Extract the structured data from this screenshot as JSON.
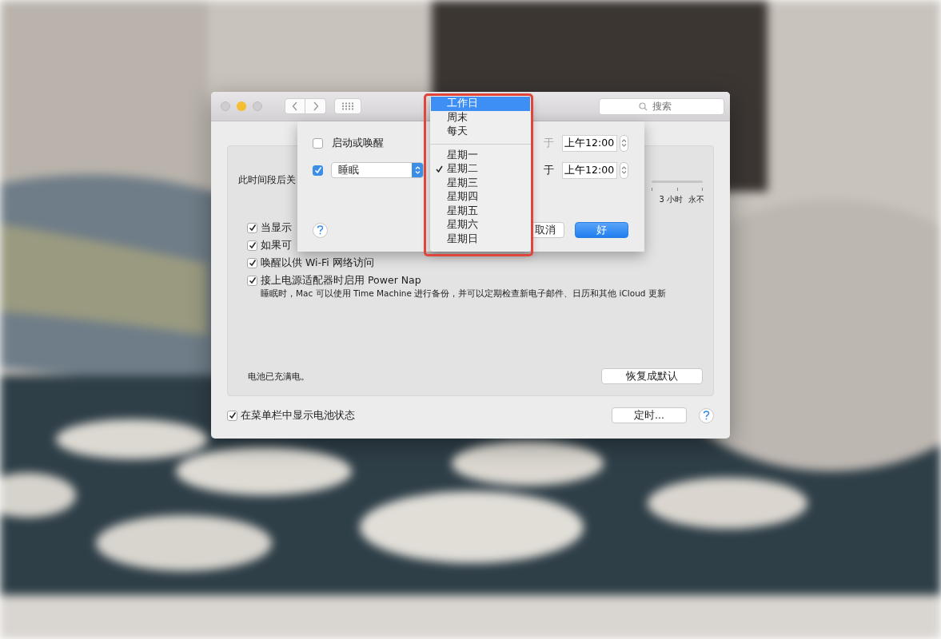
{
  "toolbar": {
    "search": {
      "placeholder": "搜索"
    }
  },
  "panel": {
    "slider_label": "此时间段后关",
    "slider_labels": [
      "3 小时",
      "永不"
    ],
    "options": [
      {
        "label": "当显示",
        "checked": true
      },
      {
        "label": "如果可",
        "checked": true
      },
      {
        "label": "唤醒以供 Wi-Fi 网络访问",
        "checked": true
      },
      {
        "label": "接上电源适配器时启用 Power Nap",
        "checked": true
      }
    ],
    "note": "睡眠时，Mac 可以使用 Time Machine 进行备份，并可以定期检查新电子邮件、日历和其他 iCloud 更新",
    "battery_status": "电池已充满电。",
    "restore_button": "恢复成默认"
  },
  "footer": {
    "show_battery": {
      "label": "在菜单栏中显示电池状态",
      "checked": true
    },
    "schedule_button": "定时..."
  },
  "schedule_sheet": {
    "rows": [
      {
        "kind": "label",
        "checked": false,
        "event": "启动或唤醒",
        "at": "于",
        "time": "上午12:00"
      },
      {
        "kind": "popup",
        "checked": true,
        "event": "睡眠",
        "at": "于",
        "time": "上午12:00"
      }
    ],
    "cancel_button": "取消",
    "ok_button": "好"
  },
  "day_menu": {
    "groups": [
      [
        {
          "label": "工作日",
          "selected": true,
          "checked": false
        },
        {
          "label": "周末",
          "selected": false,
          "checked": false
        },
        {
          "label": "每天",
          "selected": false,
          "checked": false
        }
      ],
      [
        {
          "label": "星期一",
          "selected": false,
          "checked": false
        },
        {
          "label": "星期二",
          "selected": false,
          "checked": true
        },
        {
          "label": "星期三",
          "selected": false,
          "checked": false
        },
        {
          "label": "星期四",
          "selected": false,
          "checked": false
        },
        {
          "label": "星期五",
          "selected": false,
          "checked": false
        },
        {
          "label": "星期六",
          "selected": false,
          "checked": false
        },
        {
          "label": "星期日",
          "selected": false,
          "checked": false
        }
      ]
    ]
  }
}
